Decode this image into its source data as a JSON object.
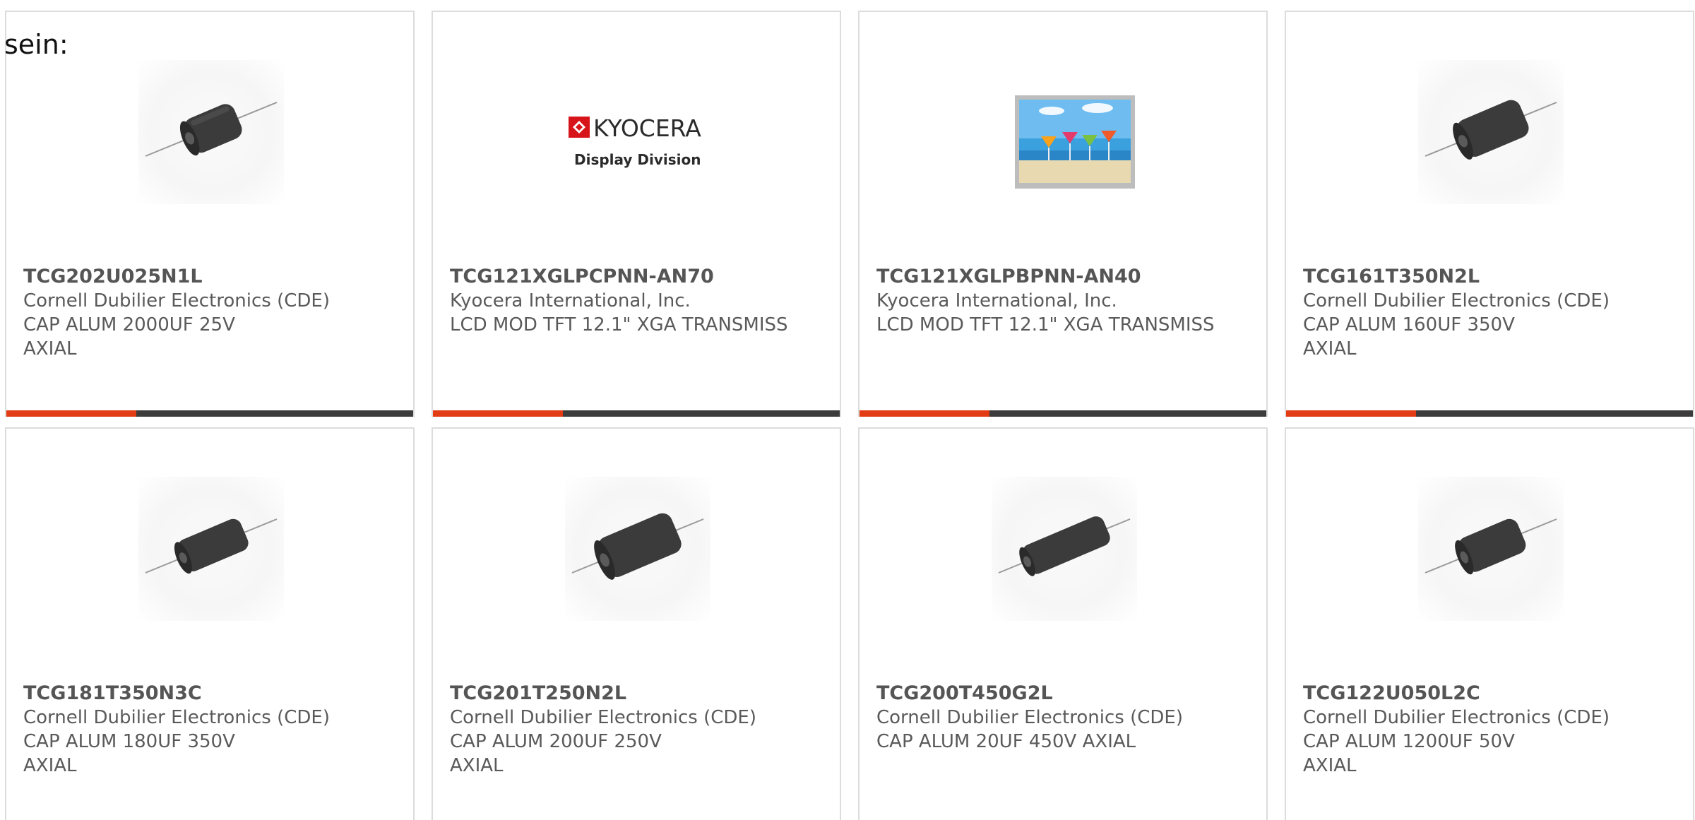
{
  "intro_text": "sein:",
  "colors": {
    "accent": "#e33b13",
    "bar_dark": "#3c3c3c",
    "border": "#dcdcdc",
    "text": "#5a5a5a"
  },
  "products": [
    {
      "part_number": "TCG202U025N1L",
      "manufacturer": "Cornell Dubilier Electronics (CDE)",
      "description": "CAP ALUM 2000UF 25V AXIAL",
      "image": "axial-capacitor-icon"
    },
    {
      "part_number": "TCG121XGLPCPNN-AN70",
      "manufacturer": "Kyocera International, Inc.",
      "description": "LCD MOD TFT 12.1\" XGA TRANSMISS",
      "image": "kyocera-logo",
      "logo": {
        "brand": "KYOCERA",
        "subtitle": "Display Division"
      }
    },
    {
      "part_number": "TCG121XGLPBPNN-AN40",
      "manufacturer": "Kyocera International, Inc.",
      "description": "LCD MOD TFT 12.1\" XGA TRANSMISS",
      "image": "lcd-module-icon"
    },
    {
      "part_number": "TCG161T350N2L",
      "manufacturer": "Cornell Dubilier Electronics (CDE)",
      "description": "CAP ALUM 160UF 350V AXIAL",
      "image": "axial-capacitor-icon"
    },
    {
      "part_number": "TCG181T350N3C",
      "manufacturer": "Cornell Dubilier Electronics (CDE)",
      "description": "CAP ALUM 180UF 350V AXIAL",
      "image": "axial-capacitor-icon"
    },
    {
      "part_number": "TCG201T250N2L",
      "manufacturer": "Cornell Dubilier Electronics (CDE)",
      "description": "CAP ALUM 200UF 250V AXIAL",
      "image": "axial-capacitor-icon"
    },
    {
      "part_number": "TCG200T450G2L",
      "manufacturer": "Cornell Dubilier Electronics (CDE)",
      "description": "CAP ALUM 20UF 450V AXIAL",
      "image": "axial-capacitor-icon"
    },
    {
      "part_number": "TCG122U050L2C",
      "manufacturer": "Cornell Dubilier Electronics (CDE)",
      "description": "CAP ALUM 1200UF 50V AXIAL",
      "image": "axial-capacitor-icon"
    }
  ]
}
